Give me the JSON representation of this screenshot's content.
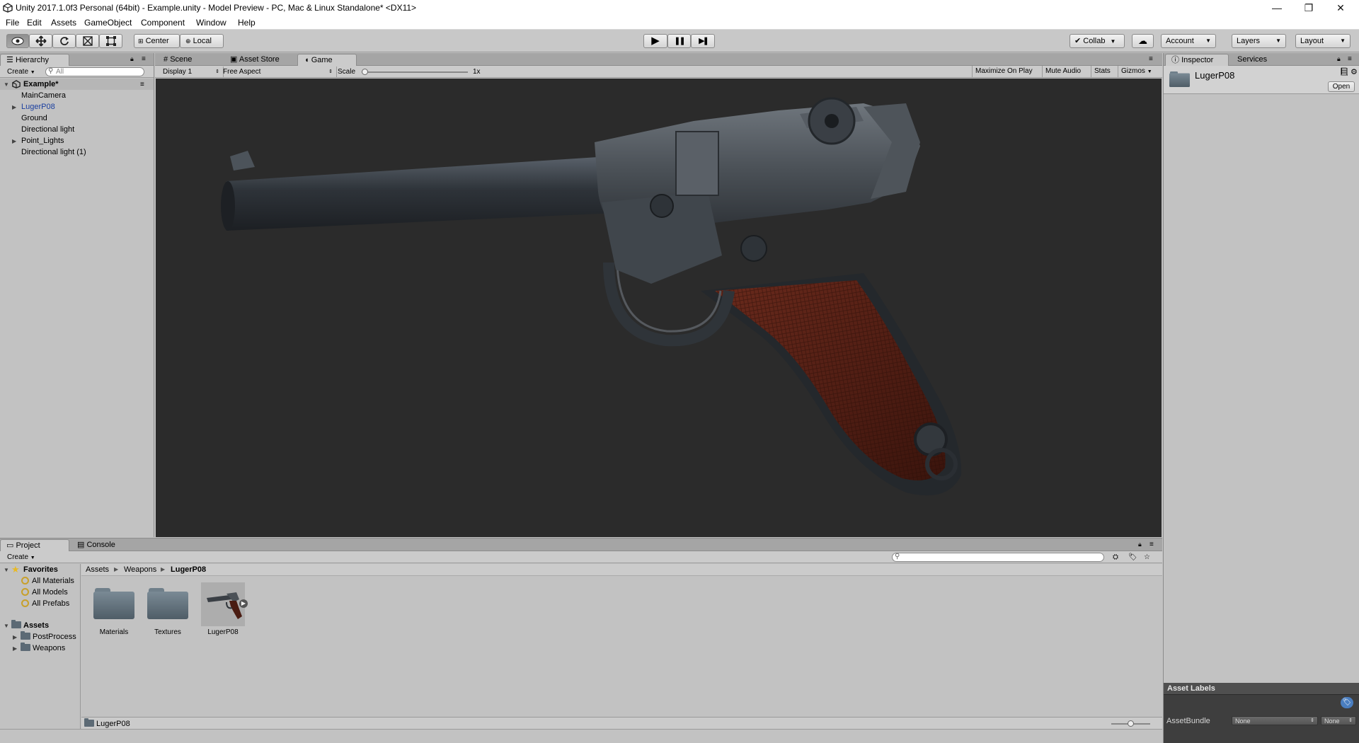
{
  "window": {
    "title": "Unity 2017.1.0f3 Personal (64bit) - Example.unity - Model Preview - PC, Mac & Linux Standalone* <DX11>",
    "controls": [
      "—",
      "❐",
      "✕"
    ]
  },
  "menu": [
    "File",
    "Edit",
    "Assets",
    "GameObject",
    "Component",
    "Window",
    "Help"
  ],
  "toolbar": {
    "tools": [
      "view-tool",
      "move-tool",
      "rotate-tool",
      "scale-tool",
      "rect-tool"
    ],
    "pivot": "Center",
    "space": "Local",
    "play": "▶",
    "pause": "❚❚",
    "step": "▶❚",
    "collab": "Collab",
    "account": "Account",
    "layers": "Layers",
    "layout": "Layout"
  },
  "hierarchy": {
    "tab": "Hierarchy",
    "create": "Create",
    "search_placeholder": "All",
    "scene": "Example*",
    "items": [
      {
        "label": "MainCamera",
        "has_children": false,
        "selected": false
      },
      {
        "label": "LugerP08",
        "has_children": true,
        "selected": true
      },
      {
        "label": "Ground",
        "has_children": false,
        "selected": false
      },
      {
        "label": "Directional light",
        "has_children": false,
        "selected": false
      },
      {
        "label": "Point_Lights",
        "has_children": true,
        "selected": false
      },
      {
        "label": "Directional light (1)",
        "has_children": false,
        "selected": false
      }
    ]
  },
  "center_tabs": [
    "Scene",
    "Asset Store",
    "Game"
  ],
  "game": {
    "display": "Display 1",
    "aspect": "Free Aspect",
    "scale_label": "Scale",
    "scale_value": "1x",
    "scale_level": 0.0,
    "maximize": "Maximize On Play",
    "mute": "Mute Audio",
    "stats": "Stats",
    "gizmos": "Gizmos",
    "viewport_bg": "#2b2b2b"
  },
  "inspector": {
    "tabs": [
      "Inspector",
      "Services"
    ],
    "object_name": "LugerP08",
    "open_button": "Open",
    "asset_labels": "Asset Labels",
    "assetbundle_label": "AssetBundle",
    "assetbundle_value": "None",
    "assetbundle_variant": "None"
  },
  "bottom_tabs": [
    "Project",
    "Console"
  ],
  "project": {
    "create": "Create",
    "favorites_label": "Favorites",
    "favorites": [
      "All Materials",
      "All Models",
      "All Prefabs"
    ],
    "assets_label": "Assets",
    "asset_folders": [
      "PostProcess",
      "Weapons"
    ],
    "breadcrumb": [
      "Assets",
      "Weapons",
      "LugerP08"
    ],
    "items": [
      {
        "label": "Materials",
        "kind": "folder"
      },
      {
        "label": "Textures",
        "kind": "folder"
      },
      {
        "label": "LugerP08",
        "kind": "model"
      }
    ],
    "status_path": "LugerP08",
    "zoom_level": 0.5
  },
  "colors": {
    "selected_text": "#1a3fa0",
    "editor_bg": "#c2c2c2",
    "grip": "#5c2418",
    "metal": "#3a3f45"
  }
}
